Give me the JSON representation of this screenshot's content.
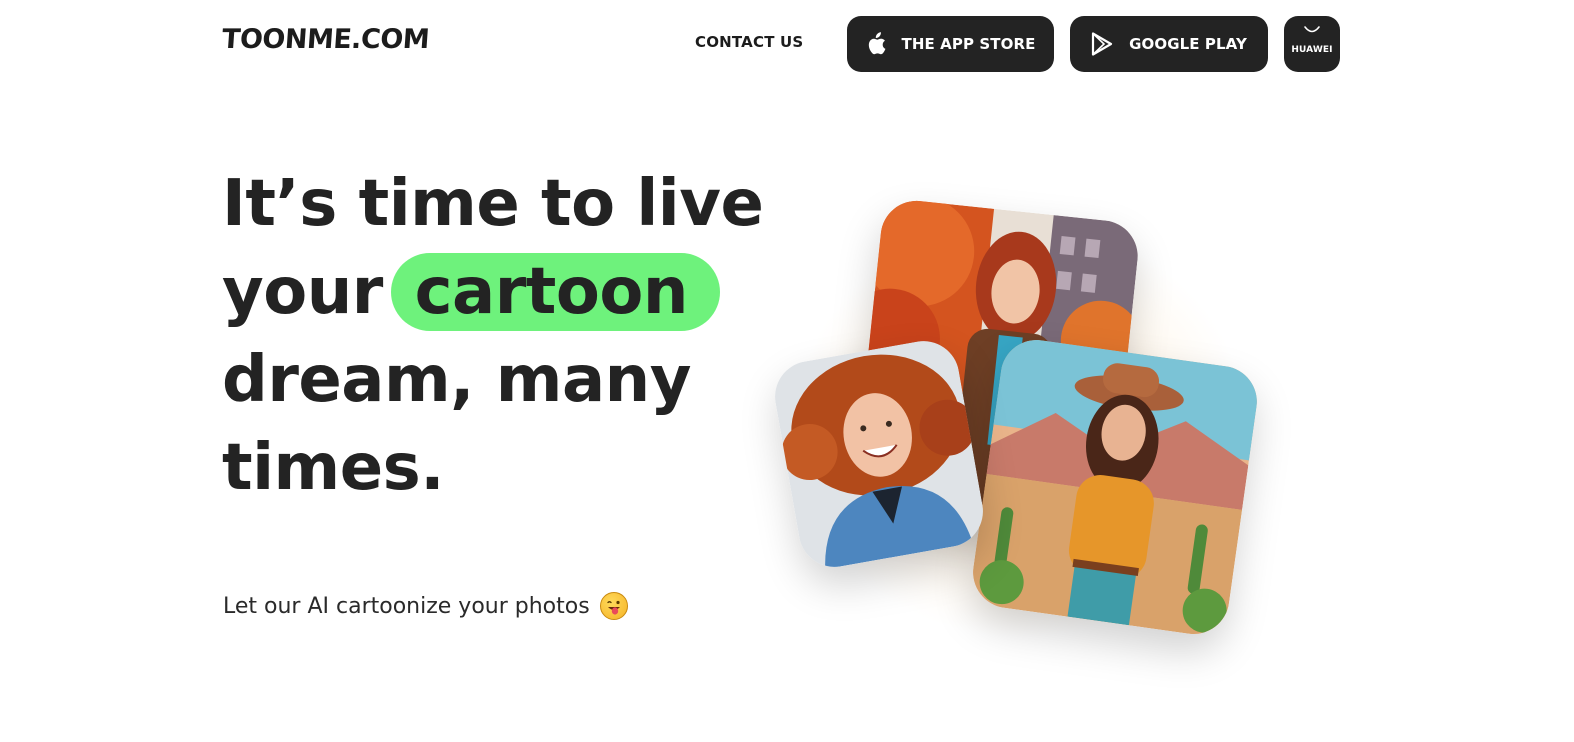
{
  "header": {
    "logo": "TOONME.COM",
    "contact_label": "CONTACT US",
    "app_store_label": "THE APP STORE",
    "google_play_label": "GOOGLE PLAY",
    "huawei_label": "HUAWEI"
  },
  "hero": {
    "headline_line1": "It’s time to live",
    "headline_line2_prefix": "your",
    "headline_highlight": "cartoon",
    "headline_line3": "dream, many",
    "headline_line4": "times.",
    "subtitle": "Let our AI cartoonize your photos",
    "highlight_color": "#6ef27c"
  },
  "icons": {
    "app_store": "apple-icon",
    "google_play": "google-play-icon",
    "huawei": "huawei-bag-icon",
    "emoji": "tongue-out-wink-emoji-icon"
  },
  "colors": {
    "button_bg": "#232323",
    "text": "#232323",
    "accent_green": "#6ef27c"
  }
}
